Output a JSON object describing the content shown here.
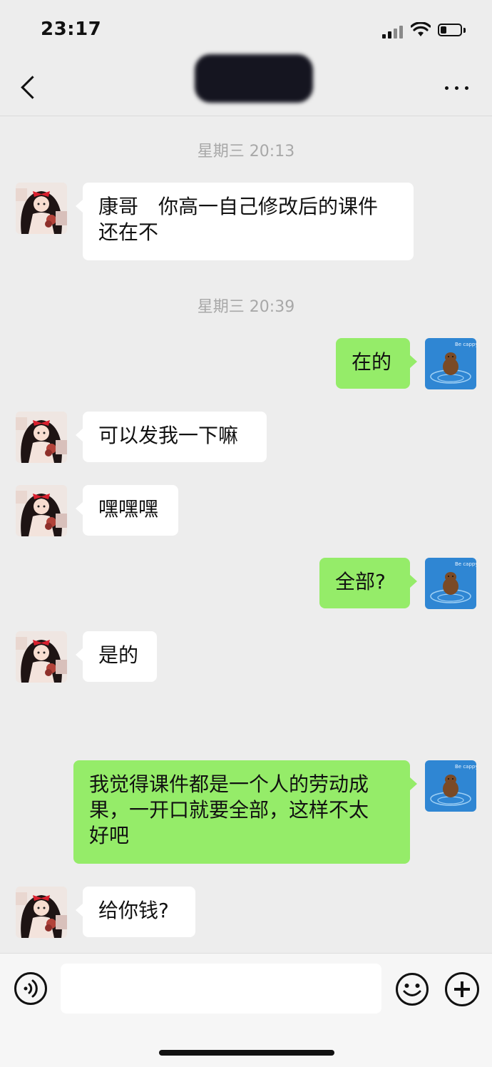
{
  "status_bar": {
    "time": "23:17",
    "battery_level": 0.3
  },
  "nav": {
    "title_redacted": true,
    "back_icon": "chevron-left-icon",
    "more_icon": "ellipsis-icon"
  },
  "timestamps": [
    "星期三 20:13",
    "星期三 20:39"
  ],
  "messages": [
    {
      "side": "in",
      "text": "康哥　你高一自己修改后的课件\n还在不"
    },
    {
      "side": "out",
      "text": "在的"
    },
    {
      "side": "in",
      "text": "可以发我一下嘛"
    },
    {
      "side": "in",
      "text": "嘿嘿嘿"
    },
    {
      "side": "out",
      "text": "全部?"
    },
    {
      "side": "in",
      "text": "是的"
    },
    {
      "side": "out",
      "text": "我觉得课件都是一个人的劳动成\n果，一开口就要全部，这样不太\n好吧"
    },
    {
      "side": "in",
      "text": "给你钱?"
    }
  ],
  "avatars": {
    "contact": {
      "icon": "girl-cartoon-avatar",
      "colors": {
        "hair": "#1e1414",
        "bow": "#d9202e",
        "dress": "#f3e3dc"
      }
    },
    "self": {
      "icon": "capybara-avatar",
      "caption": "Be cappy",
      "colors": {
        "water": "#2f86d3",
        "body": "#7a4a26"
      }
    }
  },
  "input_bar": {
    "voice_icon": "voice-icon",
    "emoji_icon": "emoji-icon",
    "plus_icon": "plus-icon",
    "placeholder": ""
  },
  "colors": {
    "background": "#ededed",
    "outgoing_bubble": "#95ec69",
    "incoming_bubble": "#ffffff",
    "timestamp_text": "#a8a8a8"
  }
}
